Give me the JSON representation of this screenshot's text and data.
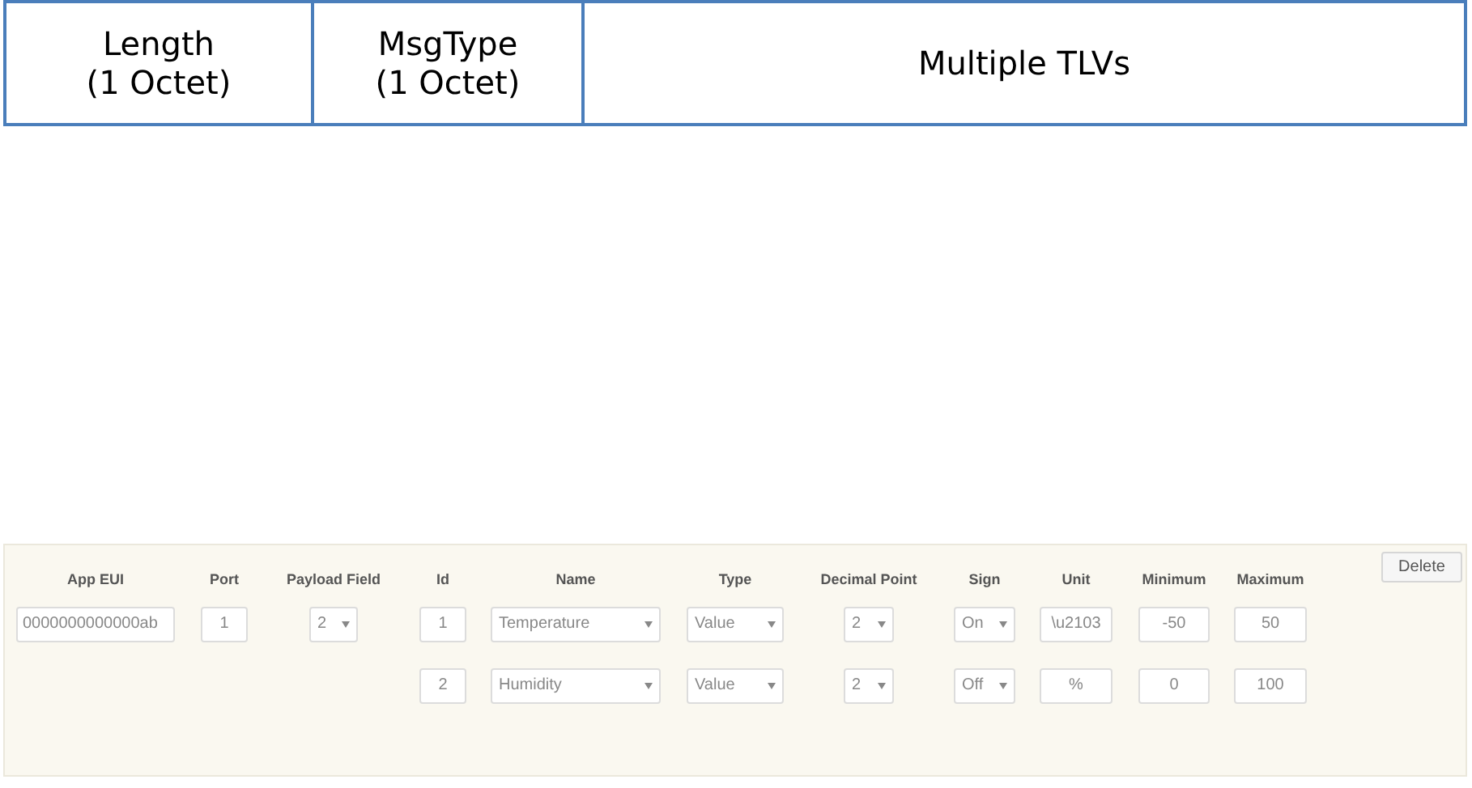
{
  "frame": {
    "fields": [
      {
        "name": "Length",
        "size": "(1 Octet)"
      },
      {
        "name": "MsgType",
        "size": "(1 Octet)"
      },
      {
        "name": "Multiple TLVs"
      }
    ]
  },
  "form": {
    "delete_button": "Delete",
    "columns": [
      "App EUI",
      "Port",
      "Payload Field",
      "Id",
      "Name",
      "Type",
      "Decimal Point",
      "Sign",
      "Unit",
      "Minimum",
      "Maximum"
    ],
    "rows": [
      {
        "app_eui": "0000000000000ab",
        "port": "1",
        "payload_field": "2",
        "id": "1",
        "name": "Temperature",
        "type": "Value",
        "decimal_point": "2",
        "sign": "On",
        "unit": "\\u2103",
        "minimum": "-50",
        "maximum": "50"
      },
      {
        "id": "2",
        "name": "Humidity",
        "type": "Value",
        "decimal_point": "2",
        "sign": "Off",
        "unit": "%",
        "minimum": "0",
        "maximum": "100"
      }
    ]
  }
}
